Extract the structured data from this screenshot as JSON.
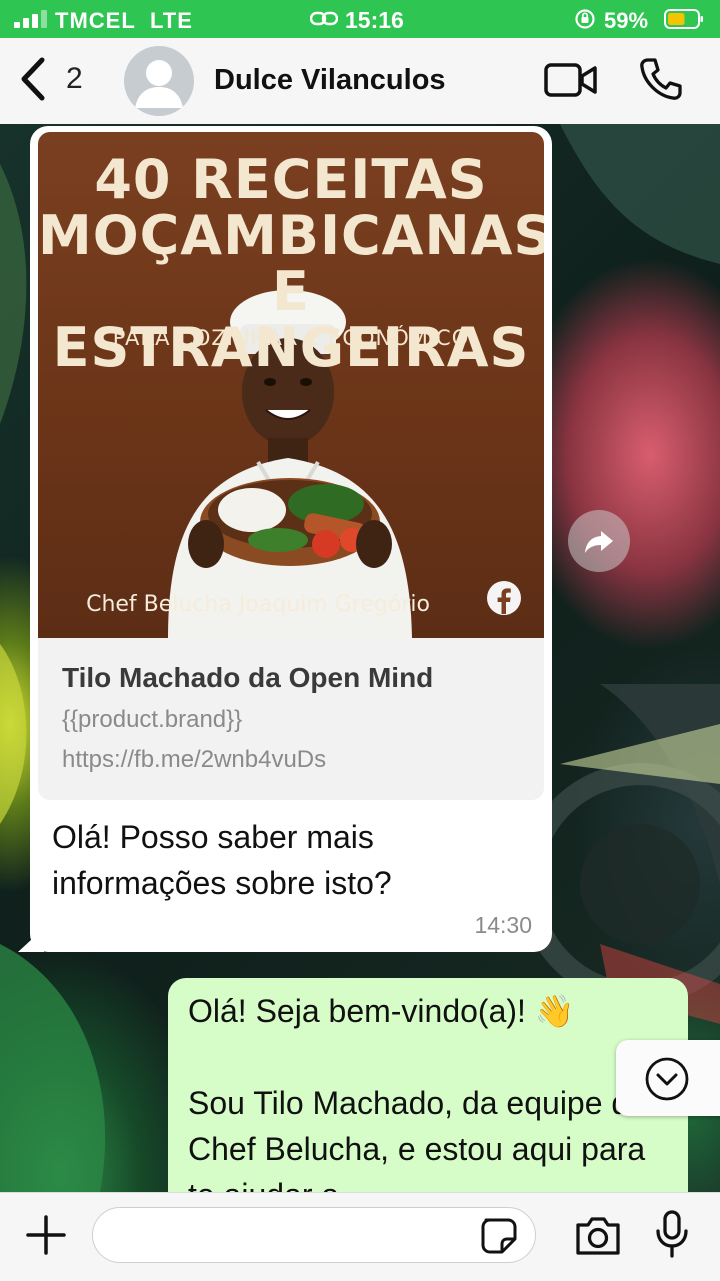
{
  "status_bar": {
    "carrier": "TMCEL",
    "network": "LTE",
    "time": "15:16",
    "battery_percent": "59%",
    "signal_bars": 3,
    "battery_level": 0.59
  },
  "header": {
    "back_count": "2",
    "contact_name": "Dulce Vilanculos"
  },
  "messages": {
    "incoming": {
      "poster": {
        "title": "40 RECEITAS\nMOÇAMBICANAS\nE ESTRANGEIRAS",
        "subtitle": "PARA COZINHAR          E ECONÓMICO",
        "author": "Chef Belucha Joaquim Gregório"
      },
      "link_title": "Tilo Machado da Open Mind",
      "link_brand": "{{product.brand}}",
      "link_url": "https://fb.me/2wnb4vuDs",
      "text": "Olá! Posso saber mais informações sobre isto?",
      "time": "14:30"
    },
    "outgoing": {
      "text": "Olá! Seja bem-vindo(a)! 👋\n\nSou Tilo Machado, da equipe da Chef Belucha, e estou aqui para te ajudar a"
    }
  },
  "input": {
    "placeholder": ""
  },
  "colors": {
    "status_bar": "#2fc552",
    "incoming_bubble": "#ffffff",
    "outgoing_bubble": "#d6fdc8",
    "battery": "#f5c400"
  }
}
